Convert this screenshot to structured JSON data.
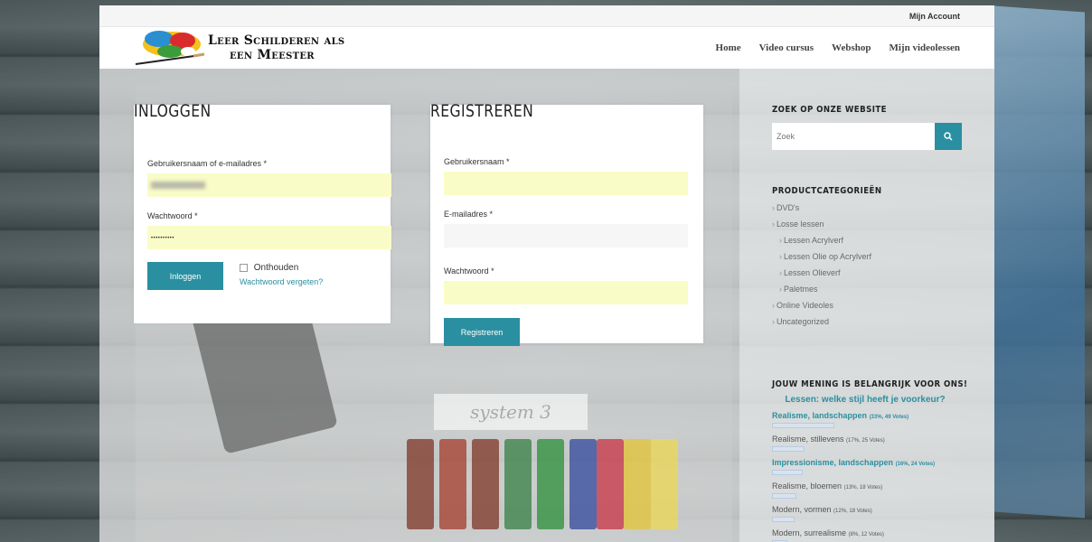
{
  "topbar": {
    "account_label": "Mijn Account"
  },
  "header": {
    "logo_line1": "Leer Schilderen als",
    "logo_line2": "een Meester",
    "nav": [
      "Home",
      "Video cursus",
      "Webshop",
      "Mijn videolessen"
    ]
  },
  "login": {
    "title": "INLOGGEN",
    "username_label": "Gebruikersnaam of e-mailadres *",
    "password_label": "Wachtwoord *",
    "password_value": "••••••••••",
    "submit_label": "Inloggen",
    "remember_label": "Onthouden",
    "forgot_label": "Wachtwoord vergeten?"
  },
  "register": {
    "title": "REGISTREREN",
    "username_label": "Gebruikersnaam *",
    "email_label": "E-mailadres *",
    "password_label": "Wachtwoord *",
    "submit_label": "Registreren"
  },
  "photo": {
    "box_text": "system 3"
  },
  "sidebar": {
    "search_title": "ZOEK OP ONZE WEBSITE",
    "search_placeholder": "Zoek",
    "categories_title": "PRODUCTCATEGORIEËN",
    "categories": [
      {
        "label": "DVD's",
        "level": 0
      },
      {
        "label": "Losse lessen",
        "level": 0
      },
      {
        "label": "Lessen Acrylverf",
        "level": 1
      },
      {
        "label": "Lessen Olie op Acrylverf",
        "level": 1
      },
      {
        "label": "Lessen Olieverf",
        "level": 1
      },
      {
        "label": "Paletmes",
        "level": 1
      },
      {
        "label": "Online Videoles",
        "level": 0
      },
      {
        "label": "Uncategorized",
        "level": 0
      }
    ],
    "poll_title": "JOUW MENING IS BELANGRIJK VOOR ONS!",
    "poll_question": "Lessen: welke stijl heeft je voorkeur?",
    "poll_options": [
      {
        "name": "Realisme, landschappen",
        "meta": "(33%, 49 Votes)",
        "percent": 33,
        "highlight": true
      },
      {
        "name": "Realisme, stillevens",
        "meta": "(17%, 25 Votes)",
        "percent": 17,
        "highlight": false
      },
      {
        "name": "Impressionisme, landschappen",
        "meta": "(16%, 24 Votes)",
        "percent": 16,
        "highlight": true
      },
      {
        "name": "Realisme, bloemen",
        "meta": "(13%, 18 Votes)",
        "percent": 13,
        "highlight": false
      },
      {
        "name": "Modern, vormen",
        "meta": "(12%, 18 Votes)",
        "percent": 12,
        "highlight": false
      },
      {
        "name": "Modern, surrealisme",
        "meta": "(8%, 12 Votes)",
        "percent": 8,
        "highlight": false
      }
    ]
  },
  "colors": {
    "accent": "#2a8fa0",
    "autofill": "#fafcc8"
  }
}
